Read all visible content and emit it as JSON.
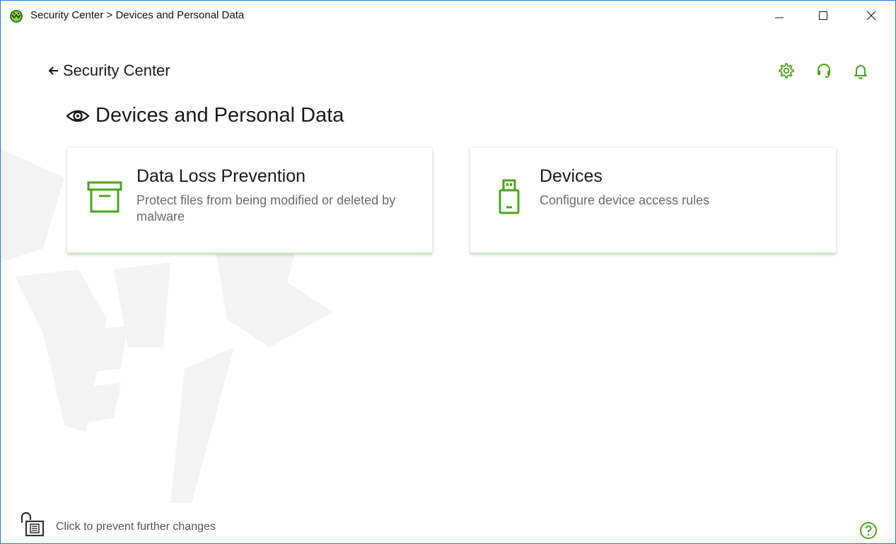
{
  "window": {
    "title": "Security Center > Devices and Personal Data",
    "app_icon": "dr-web-spider-logo",
    "controls": [
      "minimize-icon",
      "maximize-icon",
      "close-icon"
    ]
  },
  "header": {
    "back_label": "Security Center",
    "icons": [
      "gear-icon",
      "headset-icon",
      "bell-icon"
    ]
  },
  "page": {
    "title": "Devices and Personal Data",
    "title_icon": "eye-icon"
  },
  "cards": [
    {
      "title": "Data Loss Prevention",
      "description": "Protect files from being modified or deleted by malware",
      "icon": "archive-box-icon"
    },
    {
      "title": "Devices",
      "description": "Configure device access rules",
      "icon": "usb-drive-icon"
    }
  ],
  "footer": {
    "lock_label": "Click to prevent further changes",
    "lock_icon": "padlock-open-icon",
    "help_icon": "help-icon"
  },
  "colors": {
    "accent_green": "#4aa51c",
    "window_border": "#1f7bd6",
    "watermark": "#f3f3f3"
  }
}
